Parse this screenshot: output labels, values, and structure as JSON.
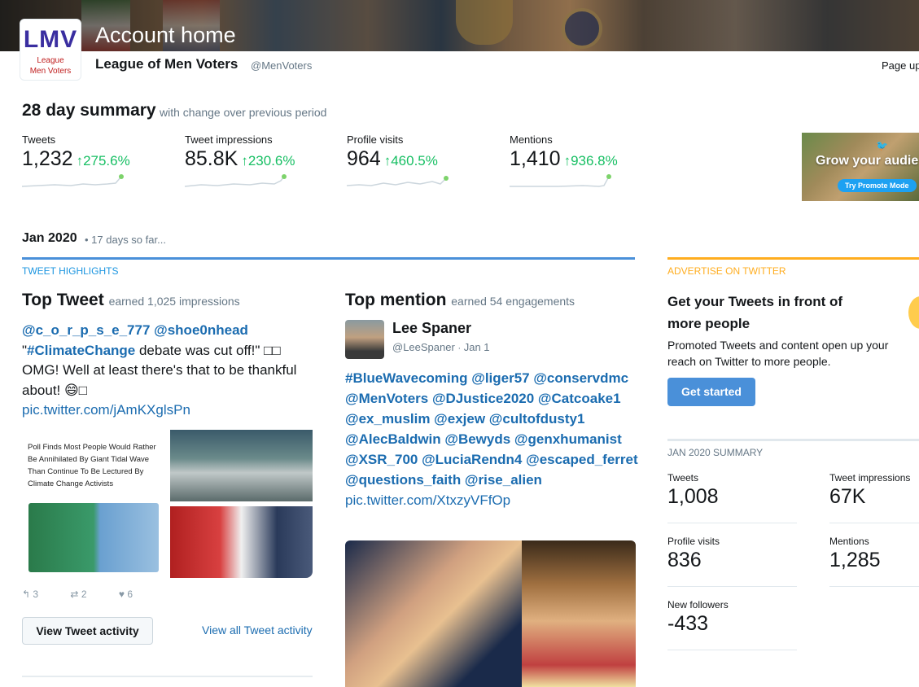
{
  "header": {
    "page_title": "Account home",
    "account_name": "League of Men Voters",
    "account_handle": "@MenVoters",
    "page_updated": "Page up",
    "avatar_logo": "LMV",
    "avatar_sub1": "League",
    "avatar_sub2": "Men Voters"
  },
  "summary": {
    "title": "28 day summary",
    "subtitle": "with change over previous period",
    "stats": [
      {
        "label": "Tweets",
        "value": "1,232",
        "change": "275.6%"
      },
      {
        "label": "Tweet impressions",
        "value": "85.8K",
        "change": "230.6%"
      },
      {
        "label": "Profile visits",
        "value": "964",
        "change": "460.5%"
      },
      {
        "label": "Mentions",
        "value": "1,410",
        "change": "936.8%"
      }
    ],
    "promo_text": "Grow your audie",
    "promo_button": "Try Promote Mode"
  },
  "month": {
    "title": "Jan 2020",
    "subtitle": "• 17 days so far..."
  },
  "highlights": {
    "section_label": "TWEET HIGHLIGHTS",
    "top_tweet": {
      "heading": "Top Tweet",
      "earned": "earned 1,025 impressions",
      "mentions": "@c_o_r_p_s_e_777 @shoe0nhead",
      "text_open": "\"",
      "hashtag": "#ClimateChange",
      "text_mid": " debate was cut off!\" □□ OMG!  Well at least there's that to be thankful about! 😄□",
      "link": "pic.twitter.com/jAmKXglsPn",
      "media_caption": "Poll Finds Most People Would Rather Be Annihilated By Giant Tidal Wave Than Continue To Be Lectured By Climate Change Activists",
      "replies": "3",
      "retweets": "2",
      "likes": "6",
      "view_button": "View Tweet activity",
      "view_all": "View all Tweet activity"
    },
    "top_mention": {
      "heading": "Top mention",
      "earned": "earned 54 engagements",
      "name": "Lee Spaner",
      "handle": "@LeeSpaner",
      "date": "Jan 1",
      "text": "#BlueWavecoming @liger57 @conservdmc @MenVoters @DJustice2020 @Catcoake1 @ex_muslim @exjew @cultofdusty1 @AlecBaldwin @Bewyds @genxhumanist @XSR_700 @LuciaRendn4 @escaped_ferret @questions_faith @rise_alien",
      "link": "pic.twitter.com/XtxzyVFfOp"
    }
  },
  "advertise": {
    "section_label": "ADVERTISE ON TWITTER",
    "heading": "Get your Tweets in front of more people",
    "body": "Promoted Tweets and content open up your reach on Twitter to more people.",
    "button": "Get started"
  },
  "jan_summary": {
    "title": "JAN 2020 SUMMARY",
    "tweets_label": "Tweets",
    "tweets_value": "1,008",
    "impressions_label": "Tweet impressions",
    "impressions_value": "67K",
    "visits_label": "Profile visits",
    "visits_value": "836",
    "mentions_label": "Mentions",
    "mentions_value": "1,285",
    "followers_label": "New followers",
    "followers_value": "-433"
  },
  "colors": {
    "positive": "#17bf63",
    "link": "#1b6cb0",
    "accent_blue": "#4a90d9",
    "accent_yellow": "#ffad1f"
  }
}
